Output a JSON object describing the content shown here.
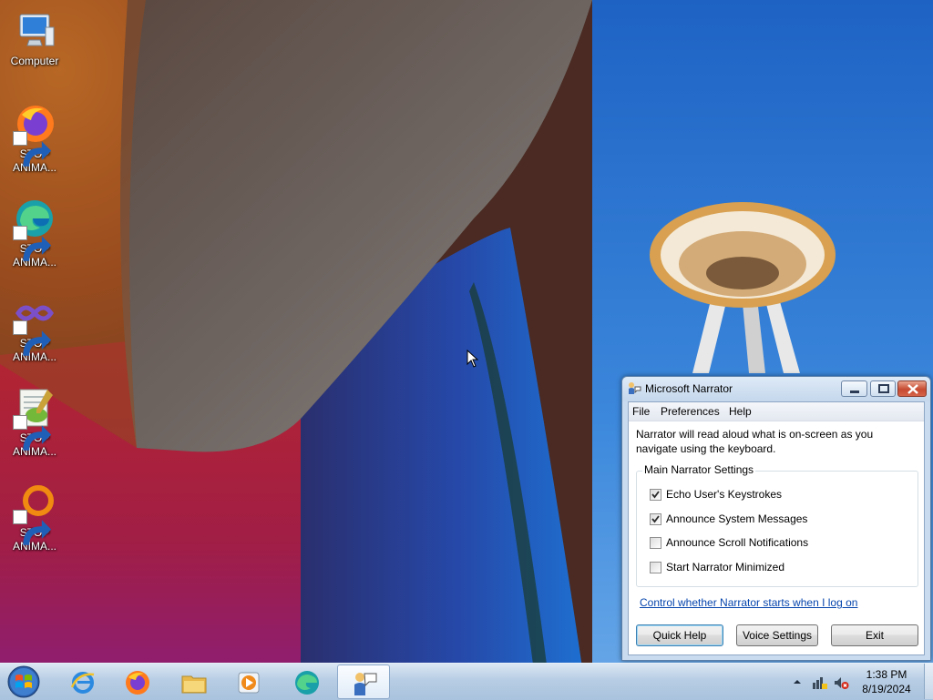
{
  "desktop": {
    "icons": [
      {
        "label": "Computer",
        "icon": "computer-icon"
      },
      {
        "label": "STOP ANIMA...",
        "icon": "firefox-icon"
      },
      {
        "label": "STOP ANIMA...",
        "icon": "edge-icon"
      },
      {
        "label": "STOP ANIMA...",
        "icon": "visual-studio-icon"
      },
      {
        "label": "STOP ANIMA...",
        "icon": "notepad-plus-plus-icon"
      },
      {
        "label": "STOP ANIMA...",
        "icon": "ring-app-icon"
      }
    ]
  },
  "narrator": {
    "title": "Microsoft Narrator",
    "menu": {
      "file": "File",
      "preferences": "Preferences",
      "help": "Help"
    },
    "description": "Narrator will read aloud what is on-screen as you navigate using the keyboard.",
    "group_title": "Main Narrator Settings",
    "options": [
      {
        "label": "Echo User's Keystrokes",
        "checked": true
      },
      {
        "label": "Announce System Messages",
        "checked": true
      },
      {
        "label": "Announce Scroll Notifications",
        "checked": false
      },
      {
        "label": "Start Narrator Minimized",
        "checked": false
      }
    ],
    "link": "Control whether Narrator starts when I log on",
    "buttons": {
      "quick_help": "Quick Help",
      "voice_settings": "Voice Settings",
      "exit": "Exit"
    }
  },
  "taskbar": {
    "pinned": [
      "internet-explorer-icon",
      "firefox-icon",
      "file-explorer-icon",
      "media-player-icon",
      "edge-icon",
      "narrator-icon"
    ],
    "clock_time": "1:38 PM",
    "clock_date": "8/19/2024"
  },
  "colors": {
    "sky": "#1e6fd0",
    "link": "#0645ad",
    "taskbar": "#b7cde4",
    "close_button": "#c64a31"
  }
}
